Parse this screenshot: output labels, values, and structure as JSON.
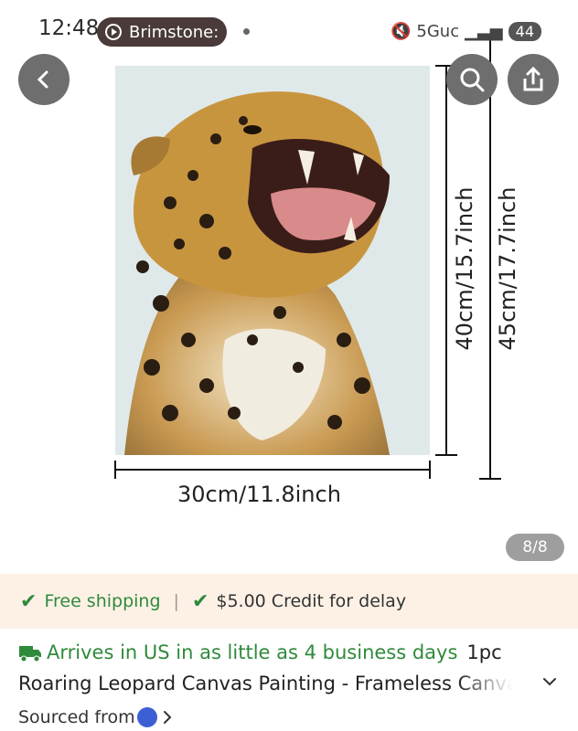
{
  "status_bar": {
    "time": "12:48",
    "app_pill": "Brimstone:",
    "network": "5Guc",
    "battery": "44"
  },
  "gallery": {
    "height_label": "40cm/15.7inch",
    "frame_height_label": "45cm/17.7inch",
    "width_label": "30cm/11.8inch",
    "counter": "8/8"
  },
  "shipping": {
    "free_shipping": "Free shipping",
    "credit": "$5.00 Credit for delay"
  },
  "delivery": {
    "arrival": "Arrives in US in as little as 4 business days",
    "quantity": "1pc"
  },
  "product": {
    "title": "Roaring Leopard Canvas Painting - Frameless Canvas",
    "sourced_from": "Sourced from"
  },
  "colors": {
    "accent_green": "#2f8a3b",
    "ship_bar_bg": "#fdf1e6"
  }
}
